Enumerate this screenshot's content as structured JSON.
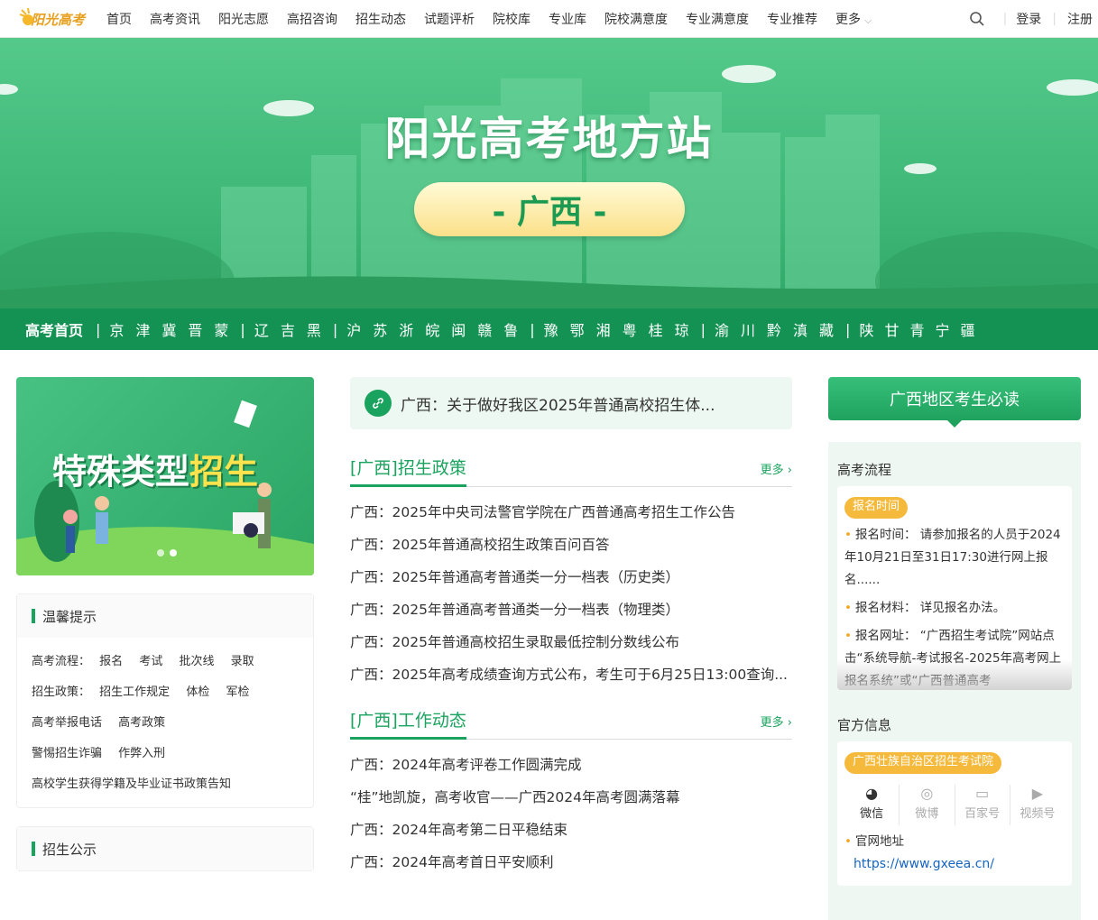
{
  "nav": {
    "logo_text": "阳光高考",
    "items": [
      "首页",
      "高考资讯",
      "阳光志愿",
      "高招咨询",
      "招生动态",
      "试题评析",
      "院校库",
      "专业库",
      "院校满意度",
      "专业满意度",
      "专业推荐",
      "更多"
    ],
    "login": "登录",
    "register": "注册"
  },
  "hero": {
    "title": "阳光高考地方站",
    "region": "- 广西 -"
  },
  "provbar": {
    "home": "高考首页",
    "groups": [
      "京津冀晋蒙",
      "辽吉黑",
      "沪苏浙皖闽赣鲁",
      "豫鄂湘粤桂琼",
      "渝川黔滇藏",
      "陕甘青宁疆"
    ],
    "sep": "|"
  },
  "left": {
    "banner_title_a": "特殊类型",
    "banner_title_b": "招生",
    "tips_title": "温馨提示",
    "tips_rows": [
      [
        "高考流程：",
        "报名",
        "考试",
        "批次线",
        "录取"
      ],
      [
        "招生政策：",
        "招生工作规定",
        "体检",
        "军检"
      ],
      [
        "高考举报电话",
        "高考政策"
      ],
      [
        "警惕招生诈骗",
        "作弊入刑"
      ],
      [
        "高校学生获得学籍及毕业证书政策告知"
      ]
    ],
    "pub_title": "招生公示"
  },
  "mid": {
    "notice": "广西：关于做好我区2025年普通高校招生体...",
    "policy_title": "[广西]招生政策",
    "more": "更多",
    "policy_items": [
      "广西：2025年中央司法警官学院在广西普通高考招生工作公告",
      "广西：2025年普通高校招生政策百问百答",
      "广西：2025年普通高考普通类一分一档表（历史类）",
      "广西：2025年普通高考普通类一分一档表（物理类）",
      "广西：2025年普通高校招生录取最低控制分数线公布",
      "广西：2025年高考成绩查询方式公布，考生可于6月25日13:00查询..."
    ],
    "work_title": "[广西]工作动态",
    "work_items": [
      "广西：2024年高考评卷工作圆满完成",
      "“桂”地凯旋，高考收官——广西2024年高考圆满落幕",
      "广西：2024年高考第二日平稳结束",
      "广西：2024年高考首日平安顺利"
    ]
  },
  "right": {
    "header": "广西地区考生必读",
    "flow_title": "高考流程",
    "flow_badge": "报名时间",
    "flow_items": [
      {
        "k": "报名时间：",
        "v": "请参加报名的人员于2024年10月21日至31日17:30进行网上报名......"
      },
      {
        "k": "报名材料：",
        "v": "详见报名办法。"
      },
      {
        "k": "报名网址：",
        "v": "“广西招生考试院”网站点击“系统导航-考试报名-2025年高考网上报名系统”或“广西普通高考"
      }
    ],
    "official_title": "官方信息",
    "official_badge": "广西壮族自治区招生考试院",
    "socials": [
      "微信",
      "微博",
      "百家号",
      "视频号"
    ],
    "site_label": "官网地址",
    "site_url": "https://www.gxeea.cn/"
  }
}
